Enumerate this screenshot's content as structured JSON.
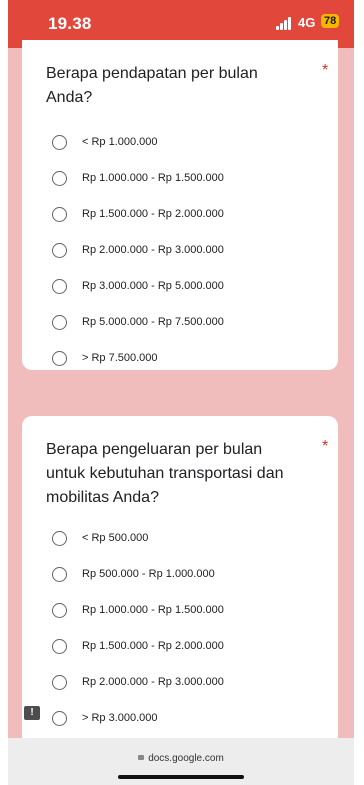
{
  "status_bar": {
    "time": "19.38",
    "network": "4G",
    "battery": "78"
  },
  "question1": {
    "title": "Berapa pendapatan per bulan Anda?",
    "required_marker": "*",
    "options": [
      "< Rp 1.000.000",
      "Rp 1.000.000 - Rp 1.500.000",
      "Rp 1.500.000 - Rp 2.000.000",
      "Rp 2.000.000 - Rp 3.000.000",
      "Rp 3.000.000 - Rp 5.000.000",
      "Rp 5.000.000 - Rp 7.500.000",
      "> Rp 7.500.000"
    ]
  },
  "question2": {
    "title": "Berapa pengeluaran per bulan untuk kebutuhan transportasi dan mobilitas Anda?",
    "required_marker": "*",
    "options": [
      "< Rp 500.000",
      "Rp 500.000 - Rp 1.000.000",
      "Rp 1.000.000 - Rp 1.500.000",
      "Rp 1.500.000 - Rp 2.000.000",
      "Rp 2.000.000 - Rp 3.000.000",
      "> Rp 3.000.000"
    ]
  },
  "address_bar": {
    "url": "docs.google.com"
  },
  "feedback_button": {
    "label": "!"
  },
  "colors": {
    "status_bar": "#e2473c",
    "page_background": "#f1bcbc",
    "required": "#d93025",
    "battery": "#f5b700"
  },
  "icons": [
    "signal-icon",
    "lock-icon",
    "radio-icon",
    "feedback-icon"
  ]
}
